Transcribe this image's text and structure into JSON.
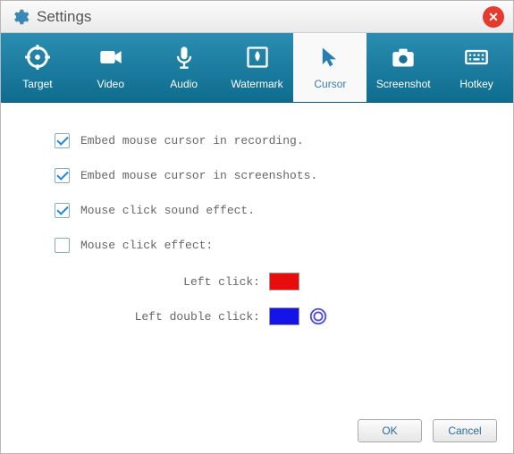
{
  "window": {
    "title": "Settings"
  },
  "tabs": [
    {
      "label": "Target"
    },
    {
      "label": "Video"
    },
    {
      "label": "Audio"
    },
    {
      "label": "Watermark"
    },
    {
      "label": "Cursor"
    },
    {
      "label": "Screenshot"
    },
    {
      "label": "Hotkey"
    }
  ],
  "options": {
    "embed_cursor_recording": "Embed mouse cursor in recording.",
    "embed_cursor_screenshots": "Embed mouse cursor in screenshots.",
    "click_sound": "Mouse click sound effect.",
    "click_effect": "Mouse click effect:"
  },
  "click_effect": {
    "left_click_label": "Left click:",
    "left_double_click_label": "Left double click:",
    "left_click_color": "#e80c0c",
    "left_double_click_color": "#1414e8"
  },
  "buttons": {
    "ok": "OK",
    "cancel": "Cancel"
  }
}
